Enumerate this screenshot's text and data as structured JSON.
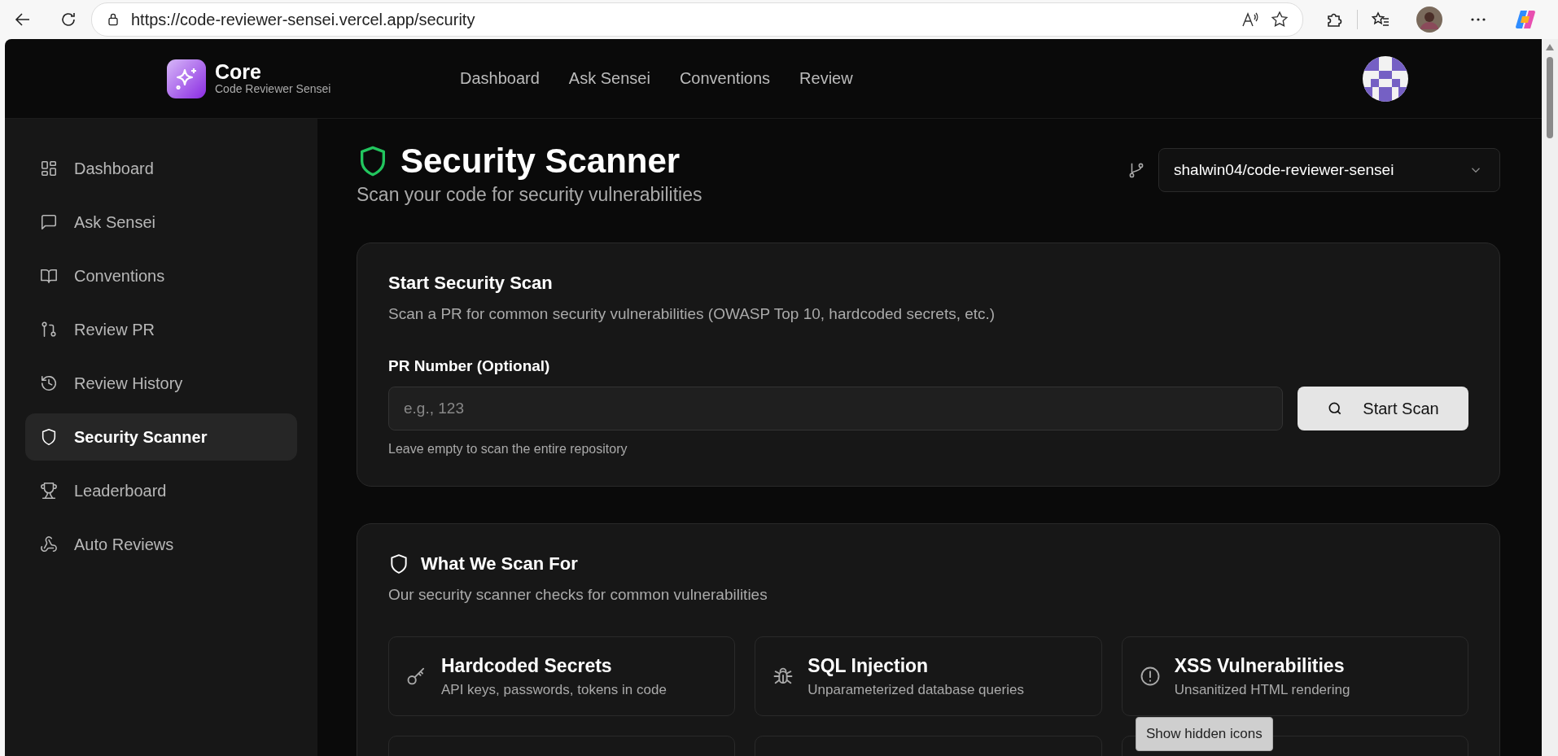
{
  "browser": {
    "url": "https://code-reviewer-sensei.vercel.app/security"
  },
  "app": {
    "name": "Core",
    "subtitle": "Code Reviewer Sensei"
  },
  "nav": [
    "Dashboard",
    "Ask Sensei",
    "Conventions",
    "Review"
  ],
  "sidebar": {
    "items": [
      {
        "label": "Dashboard",
        "kind": "grid",
        "selected": false
      },
      {
        "label": "Ask Sensei",
        "kind": "chat",
        "selected": false
      },
      {
        "label": "Conventions",
        "kind": "book",
        "selected": false
      },
      {
        "label": "Review PR",
        "kind": "pull",
        "selected": false
      },
      {
        "label": "Review History",
        "kind": "history",
        "selected": false
      },
      {
        "label": "Security Scanner",
        "kind": "shield",
        "selected": true
      },
      {
        "label": "Leaderboard",
        "kind": "trophy",
        "selected": false
      },
      {
        "label": "Auto Reviews",
        "kind": "webhook",
        "selected": false
      }
    ]
  },
  "page": {
    "title": "Security Scanner",
    "subtitle": "Scan your code for security vulnerabilities",
    "repo": "shalwin04/code-reviewer-sensei"
  },
  "scan_card": {
    "title": "Start Security Scan",
    "description": "Scan a PR for common security vulnerabilities (OWASP Top 10, hardcoded secrets, etc.)",
    "field_label": "PR Number (Optional)",
    "placeholder": "e.g., 123",
    "button": "Start Scan",
    "hint": "Leave empty to scan the entire repository"
  },
  "scan_for": {
    "title": "What We Scan For",
    "description": "Our security scanner checks for common vulnerabilities",
    "features": [
      {
        "kind": "key",
        "title": "Hardcoded Secrets",
        "description": "API keys, passwords, tokens in code"
      },
      {
        "kind": "bug",
        "title": "SQL Injection",
        "description": "Unparameterized database queries"
      },
      {
        "kind": "alert",
        "title": "XSS Vulnerabilities",
        "description": "Unsanitized HTML rendering"
      }
    ]
  },
  "tooltip": "Show hidden icons"
}
